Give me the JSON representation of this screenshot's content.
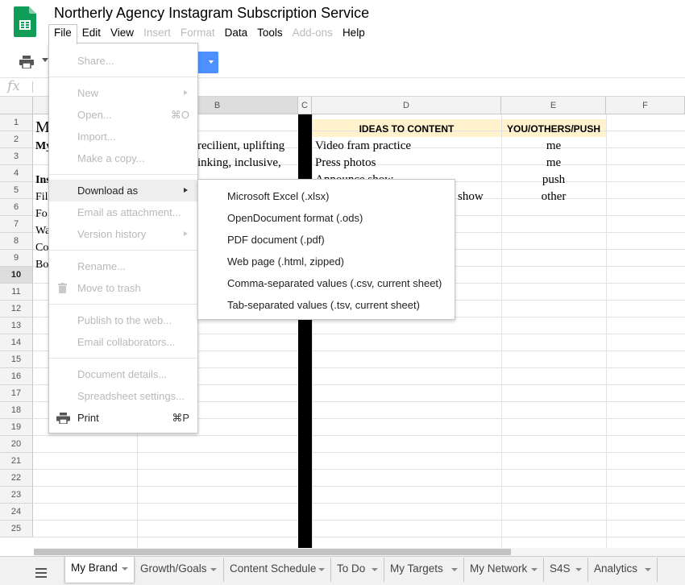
{
  "app": {
    "title": "Northerly Agency Instagram Subscription Service",
    "logo_icon": "sheets-logo-icon",
    "brand_color": "#0f9d58"
  },
  "menubar": [
    {
      "label": "File",
      "enabled": true,
      "active": true
    },
    {
      "label": "Edit",
      "enabled": true
    },
    {
      "label": "View",
      "enabled": true
    },
    {
      "label": "Insert",
      "enabled": false
    },
    {
      "label": "Format",
      "enabled": false
    },
    {
      "label": "Data",
      "enabled": true
    },
    {
      "label": "Tools",
      "enabled": true
    },
    {
      "label": "Add-ons",
      "enabled": false
    },
    {
      "label": "Help",
      "enabled": true
    }
  ],
  "toolbar": {
    "print_icon": "print-icon",
    "accent": "#4d90fe"
  },
  "formula_bar": {
    "fx_label": "fx",
    "value": ""
  },
  "columns": [
    "B",
    "C",
    "D",
    "E",
    "F"
  ],
  "rows": [
    "1",
    "2",
    "3",
    "4",
    "5",
    "6",
    "7",
    "8",
    "9",
    "10",
    "11",
    "12",
    "13",
    "14",
    "15",
    "16",
    "17",
    "18",
    "19",
    "20",
    "21",
    "22",
    "23",
    "24",
    "25"
  ],
  "selected_row": "10",
  "cells": {
    "A1": "M",
    "A2": "My",
    "A4": "Ins",
    "A5": "Filt",
    "A6": "Fo",
    "A7": "Wa",
    "A8": "Co",
    "A9": "Bo",
    "B2": "recilient, uplifting",
    "B3": "inking, inclusive,",
    "D1": "IDEAS TO CONTENT",
    "E1": "YOU/OTHERS/PUSH",
    "D2": "Video fram practice",
    "D3": "Press photos",
    "D4": "Announce show",
    "D5": "show",
    "E2": "me",
    "E3": "me",
    "E4": "push",
    "E5": "other"
  },
  "header_fill": "#fff2cc",
  "file_menu": {
    "items": [
      {
        "label": "Share...",
        "enabled": false
      },
      {
        "label": "New",
        "enabled": false,
        "submenu": true
      },
      {
        "label": "Open...",
        "enabled": false,
        "shortcut": "⌘O"
      },
      {
        "label": "Import...",
        "enabled": false
      },
      {
        "label": "Make a copy...",
        "enabled": false
      },
      {
        "label": "Download as",
        "enabled": true,
        "submenu": true,
        "highlighted": true
      },
      {
        "label": "Email as attachment...",
        "enabled": false
      },
      {
        "label": "Version history",
        "enabled": false,
        "submenu": true
      },
      {
        "label": "Rename...",
        "enabled": false
      },
      {
        "label": "Move to trash",
        "enabled": false,
        "icon": "trash-icon"
      },
      {
        "label": "Publish to the web...",
        "enabled": false
      },
      {
        "label": "Email collaborators...",
        "enabled": false
      },
      {
        "label": "Document details...",
        "enabled": false
      },
      {
        "label": "Spreadsheet settings...",
        "enabled": false
      },
      {
        "label": "Print",
        "enabled": true,
        "shortcut": "⌘P",
        "icon": "print-icon"
      }
    ]
  },
  "download_submenu": {
    "items": [
      "Microsoft Excel (.xlsx)",
      "OpenDocument format (.ods)",
      "PDF document (.pdf)",
      "Web page (.html, zipped)",
      "Comma-separated values (.csv, current sheet)",
      "Tab-separated values (.tsv, current sheet)"
    ]
  },
  "sheet_tabs": [
    {
      "label": "My Brand",
      "active": true
    },
    {
      "label": "Growth/Goals"
    },
    {
      "label": "Content Schedule"
    },
    {
      "label": "To Do"
    },
    {
      "label": "My Targets"
    },
    {
      "label": "My Network"
    },
    {
      "label": "S4S"
    },
    {
      "label": "Analytics"
    }
  ]
}
